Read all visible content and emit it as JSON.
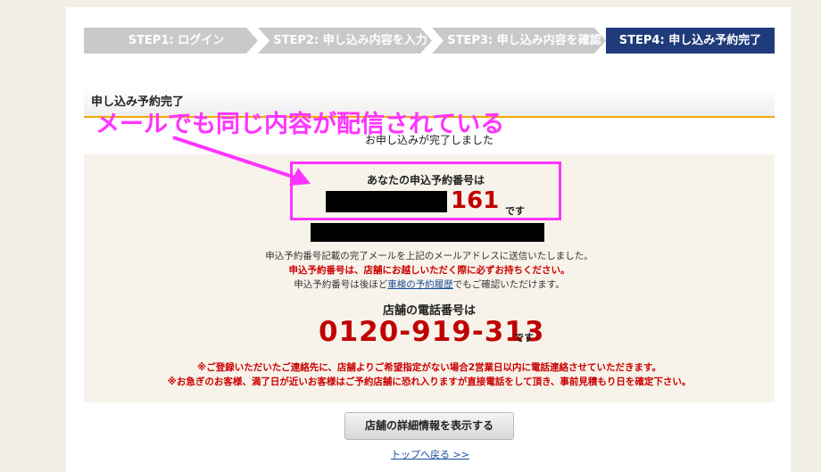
{
  "steps": [
    {
      "label": "STEP1: ログイン"
    },
    {
      "label": "STEP2: 申し込み内容を入力"
    },
    {
      "label": "STEP3: 申し込み内容を確認"
    },
    {
      "label": "STEP4: 申し込み予約完了"
    }
  ],
  "section": {
    "title": "申し込み予約完了"
  },
  "annotation": {
    "text": "メールでも同じ内容が配信されている",
    "color": "#ff33ff"
  },
  "main": {
    "complete_message": "お申し込みが完了しました",
    "reservation_label": "あなたの申込予約番号は",
    "reservation_number_visible": "161",
    "desu": "です",
    "line1": "申込予約番号記載の完了メールを上記のメールアドレスに送信いたしました。",
    "line2": "申込予約番号は、店舗にお越しいただく際に必ずお持ちください。",
    "line3_before": "申込予約番号は後ほど",
    "line3_link": "車検の予約履歴",
    "line3_after": "でもご確認いただけます。",
    "phone_label": "店舗の電話番号は",
    "phone": "0120-919-313",
    "note1": "※ご登録いただいたご連絡先に、店舗よりご希望指定がない場合2営業日以内に電話連絡させていただきます。",
    "note2": "※お急ぎのお客様、満了日が近いお客様はご予約店舗に恐れ入りますが直接電話をして頂き、事前見積もり日を確定下さい。"
  },
  "actions": {
    "store_details_button": "店舗の詳細情報を表示する",
    "top_link": "トップへ戻る >>"
  },
  "colors": {
    "active_step": "#1f3b7a",
    "accent_red": "#c00000",
    "section_underline": "#f2a900"
  }
}
